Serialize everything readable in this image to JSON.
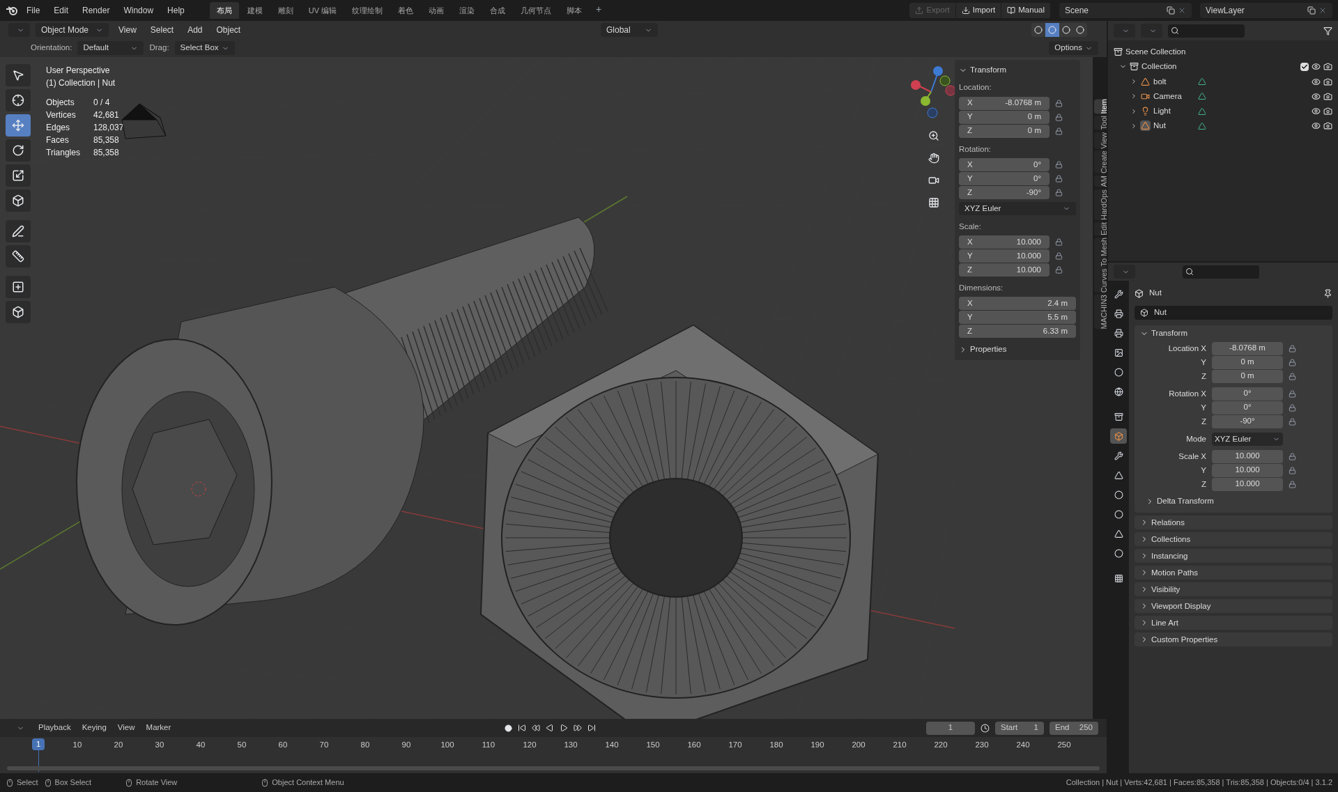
{
  "top_menu": [
    "File",
    "Edit",
    "Render",
    "Window",
    "Help"
  ],
  "workspaces": [
    {
      "label": "布局",
      "selected": true
    },
    {
      "label": "建模",
      "selected": false
    },
    {
      "label": "雕刻",
      "selected": false
    },
    {
      "label": "UV 编辑",
      "selected": false
    },
    {
      "label": "纹理绘制",
      "selected": false
    },
    {
      "label": "着色",
      "selected": false
    },
    {
      "label": "动画",
      "selected": false
    },
    {
      "label": "渲染",
      "selected": false
    },
    {
      "label": "合成",
      "selected": false
    },
    {
      "label": "几何节点",
      "selected": false
    },
    {
      "label": "脚本",
      "selected": false
    }
  ],
  "add_workspace": "+",
  "top_actions": [
    {
      "label": "Export",
      "disabled": true
    },
    {
      "label": "Import",
      "disabled": false
    },
    {
      "label": "Manual",
      "disabled": false
    }
  ],
  "scene": "Scene",
  "view_layer": "ViewLayer",
  "viewport_header": {
    "mode": "Object Mode",
    "menus": [
      "View",
      "Select",
      "Add",
      "Object"
    ],
    "orientation": "Global"
  },
  "shading_modes": [
    {
      "selected": false
    },
    {
      "selected": true
    },
    {
      "selected": false
    },
    {
      "selected": false
    }
  ],
  "tool_settings": {
    "orientation_label": "Orientation:",
    "orientation": "Default",
    "drag_label": "Drag:",
    "drag": "Select Box",
    "options": "Options"
  },
  "toolbar": [
    {
      "selected": false
    },
    {
      "selected": false
    },
    {
      "selected": true
    },
    {
      "selected": false
    },
    {
      "selected": false
    },
    {
      "selected": false
    },
    {
      "selected": false
    },
    {
      "selected": false
    },
    {
      "selected": false
    },
    {
      "selected": false
    }
  ],
  "overlay": {
    "view": "User Perspective",
    "context": "(1) Collection | Nut",
    "stats": [
      {
        "label": "Objects",
        "value": "0 / 4"
      },
      {
        "label": "Vertices",
        "value": "42,681"
      },
      {
        "label": "Edges",
        "value": "128,037"
      },
      {
        "label": "Faces",
        "value": "85,358"
      },
      {
        "label": "Triangles",
        "value": "85,358"
      }
    ]
  },
  "n_panel": {
    "title": "Transform",
    "groups": [
      {
        "label": "Location:",
        "rows": [
          {
            "axis": "X",
            "value": "-8.0768 m"
          },
          {
            "axis": "Y",
            "value": "0 m"
          },
          {
            "axis": "Z",
            "value": "0 m"
          }
        ],
        "lock": true
      },
      {
        "label": "Rotation:",
        "rows": [
          {
            "axis": "X",
            "value": "0°"
          },
          {
            "axis": "Y",
            "value": "0°"
          },
          {
            "axis": "Z",
            "value": "-90°"
          }
        ],
        "lock": true,
        "mode": "XYZ Euler"
      },
      {
        "label": "Scale:",
        "rows": [
          {
            "axis": "X",
            "value": "10.000"
          },
          {
            "axis": "Y",
            "value": "10.000"
          },
          {
            "axis": "Z",
            "value": "10.000"
          }
        ],
        "lock": true
      },
      {
        "label": "Dimensions:",
        "rows": [
          {
            "axis": "X",
            "value": "2.4 m"
          },
          {
            "axis": "Y",
            "value": "5.5 m"
          },
          {
            "axis": "Z",
            "value": "6.33 m"
          }
        ],
        "lock": false
      }
    ],
    "collapsed": "Properties"
  },
  "side_tabs": [
    {
      "label": "Item",
      "selected": true
    },
    {
      "label": "Tool",
      "selected": false
    },
    {
      "label": "View",
      "selected": false
    },
    {
      "label": "Create",
      "selected": false
    },
    {
      "label": "AM",
      "selected": false
    },
    {
      "label": "HardOps",
      "selected": false
    },
    {
      "label": "Edit",
      "selected": false
    },
    {
      "label": "Curves To Mesh",
      "selected": false
    },
    {
      "label": "MACHIN3",
      "selected": false
    }
  ],
  "outliner": {
    "root": "Scene Collection",
    "collection": {
      "name": "Collection",
      "checked": true,
      "expanded": true,
      "children": [
        {
          "name": "bolt",
          "kind": "mesh",
          "selected": false
        },
        {
          "name": "Camera",
          "kind": "camera",
          "selected": false
        },
        {
          "name": "Light",
          "kind": "light",
          "selected": false
        },
        {
          "name": "Nut",
          "kind": "mesh",
          "selected": true
        }
      ]
    }
  },
  "properties": {
    "tabs": [
      {
        "selected": false
      },
      {
        "selected": false
      },
      {
        "selected": false
      },
      {
        "selected": false
      },
      {
        "selected": false
      },
      {
        "selected": false
      },
      {
        "selected": false
      },
      {
        "selected": true
      },
      {
        "selected": false
      },
      {
        "selected": false
      },
      {
        "selected": false
      },
      {
        "selected": false
      },
      {
        "selected": false
      },
      {
        "selected": false
      },
      {
        "selected": false
      }
    ],
    "object": "Nut",
    "name_field": "Nut",
    "transform_title": "Transform",
    "groups": [
      {
        "rows": [
          {
            "label": "Location X",
            "value": "-8.0768 m",
            "kind": "number"
          },
          {
            "label": "Y",
            "value": "0 m",
            "kind": "number"
          },
          {
            "label": "Z",
            "value": "0 m",
            "kind": "number"
          }
        ]
      },
      {
        "rows": [
          {
            "label": "Rotation X",
            "value": "0°",
            "kind": "number"
          },
          {
            "label": "Y",
            "value": "0°",
            "kind": "number"
          },
          {
            "label": "Z",
            "value": "-90°",
            "kind": "number"
          }
        ]
      },
      {
        "rows": [
          {
            "label": "Mode",
            "value": "XYZ Euler",
            "kind": "dropdown"
          }
        ]
      },
      {
        "rows": [
          {
            "label": "Scale X",
            "value": "10.000",
            "kind": "number"
          },
          {
            "label": "Y",
            "value": "10.000",
            "kind": "number"
          },
          {
            "label": "Z",
            "value": "10.000",
            "kind": "number"
          }
        ]
      }
    ],
    "subpanel": "Delta Transform",
    "panels": [
      "Relations",
      "Collections",
      "Instancing",
      "Motion Paths",
      "Visibility",
      "Viewport Display",
      "Line Art",
      "Custom Properties"
    ]
  },
  "timeline": {
    "menus": [
      "Playback",
      "Keying",
      "View",
      "Marker"
    ],
    "current_frame": "1",
    "start_label": "Start",
    "start": "1",
    "end_label": "End",
    "end": "250",
    "ruler_current": "1",
    "ruler": [
      "10",
      "20",
      "30",
      "40",
      "50",
      "60",
      "70",
      "80",
      "90",
      "100",
      "110",
      "120",
      "130",
      "140",
      "150",
      "160",
      "170",
      "180",
      "190",
      "200",
      "210",
      "220",
      "230",
      "240",
      "250"
    ]
  },
  "status_bar": {
    "hints": [
      "Select",
      "Box Select",
      "Rotate View",
      "Object Context Menu"
    ],
    "info": "Collection | Nut | Verts:42,681 | Faces:85,358 | Tris:85,358 | Objects:0/4 | 3.1.2"
  }
}
